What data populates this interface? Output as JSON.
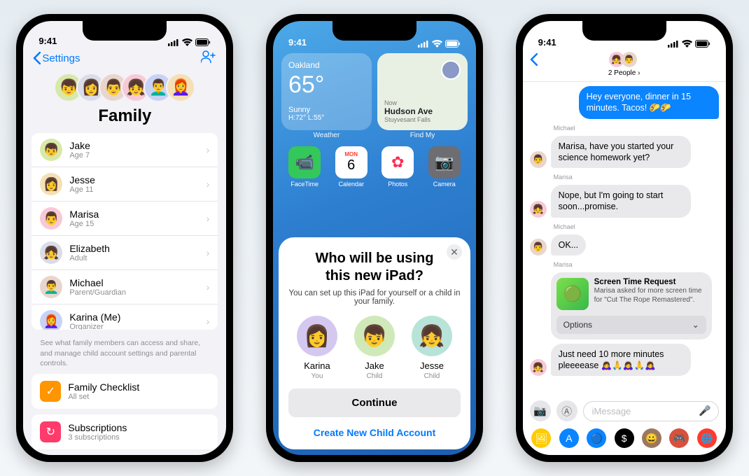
{
  "statusbar": {
    "time": "9:41"
  },
  "phone1": {
    "back_label": "Settings",
    "title": "Family",
    "avatars": [
      {
        "bg": "#d8e8a8"
      },
      {
        "bg": "#dadce8"
      },
      {
        "bg": "#e8d6cc"
      },
      {
        "bg": "#f7c9d6"
      },
      {
        "bg": "#c8d2f5"
      },
      {
        "bg": "#f5e0b5"
      }
    ],
    "members": [
      {
        "name": "Jake",
        "sub": "Age 7",
        "bg": "#d8e8a8"
      },
      {
        "name": "Jesse",
        "sub": "Age 11",
        "bg": "#f5e0b5"
      },
      {
        "name": "Marisa",
        "sub": "Age 15",
        "bg": "#f7c9d6"
      },
      {
        "name": "Elizabeth",
        "sub": "Adult",
        "bg": "#dadce8"
      },
      {
        "name": "Michael",
        "sub": "Parent/Guardian",
        "bg": "#e8d6cc"
      },
      {
        "name": "Karina (Me)",
        "sub": "Organizer",
        "bg": "#c8d2f5"
      }
    ],
    "footnote": "See what family members can access and share, and manage child account settings and parental controls.",
    "checklist": {
      "title": "Family Checklist",
      "sub": "All set",
      "icon_bg": "#ff9500"
    },
    "subs": {
      "title": "Subscriptions",
      "sub": "3 subscriptions",
      "icon_bg": "#ff3b30"
    }
  },
  "phone2": {
    "weather": {
      "location": "Oakland",
      "temp": "65°",
      "cond": "Sunny",
      "hilo": "H:72° L:55°",
      "label": "Weather"
    },
    "findmy": {
      "now": "Now",
      "place": "Hudson Ave",
      "area": "Stuyvesant Falls",
      "label": "Find My"
    },
    "apps": [
      {
        "label": "FaceTime",
        "bg": "#34c759",
        "glyph": "📹"
      },
      {
        "label": "Calendar",
        "bg": "#ffffff",
        "glyph": "6",
        "isCal": true,
        "mon": "MON"
      },
      {
        "label": "Photos",
        "bg": "#ffffff",
        "glyph": "✿",
        "color": "#ff2d55"
      },
      {
        "label": "Camera",
        "bg": "#6d6d72",
        "glyph": "📷"
      }
    ],
    "modal": {
      "title_l1": "Who will be using",
      "title_l2": "this new iPad?",
      "body": "You can set up this iPad for yourself or a child in your family.",
      "users": [
        {
          "name": "Karina",
          "sub": "You",
          "bg": "#d5c8f0"
        },
        {
          "name": "Jake",
          "sub": "Child",
          "bg": "#cfe9b8"
        },
        {
          "name": "Jesse",
          "sub": "Child",
          "bg": "#b8e3d8"
        }
      ],
      "continue": "Continue",
      "create": "Create New Child Account"
    }
  },
  "phone3": {
    "header_label": "2 People ›",
    "messages": {
      "out1": "Hey everyone, dinner in 15 minutes. Tacos! 🌮🌮",
      "s1": "Michael",
      "in1": "Marisa, have you started your science homework yet?",
      "s2": "Marisa",
      "in2": "Nope, but I'm going to start soon...promise.",
      "s3": "Michael",
      "in3": "OK...",
      "s4": "Marisa",
      "st_title": "Screen Time Request",
      "st_body": "Marisa asked for more screen time for \"Cut The Rope Remastered\".",
      "st_options": "Options",
      "in4": "Just need 10 more minutes pleeeease 🙇‍♀️🙏🙇‍♀️🙏🙇‍♀️"
    },
    "compose_placeholder": "iMessage",
    "strip_colors": [
      "#ffcc00",
      "#0a84ff",
      "#0a84ff",
      "#000",
      "#9a7860",
      "#d9503c",
      "#ff3b30"
    ]
  }
}
